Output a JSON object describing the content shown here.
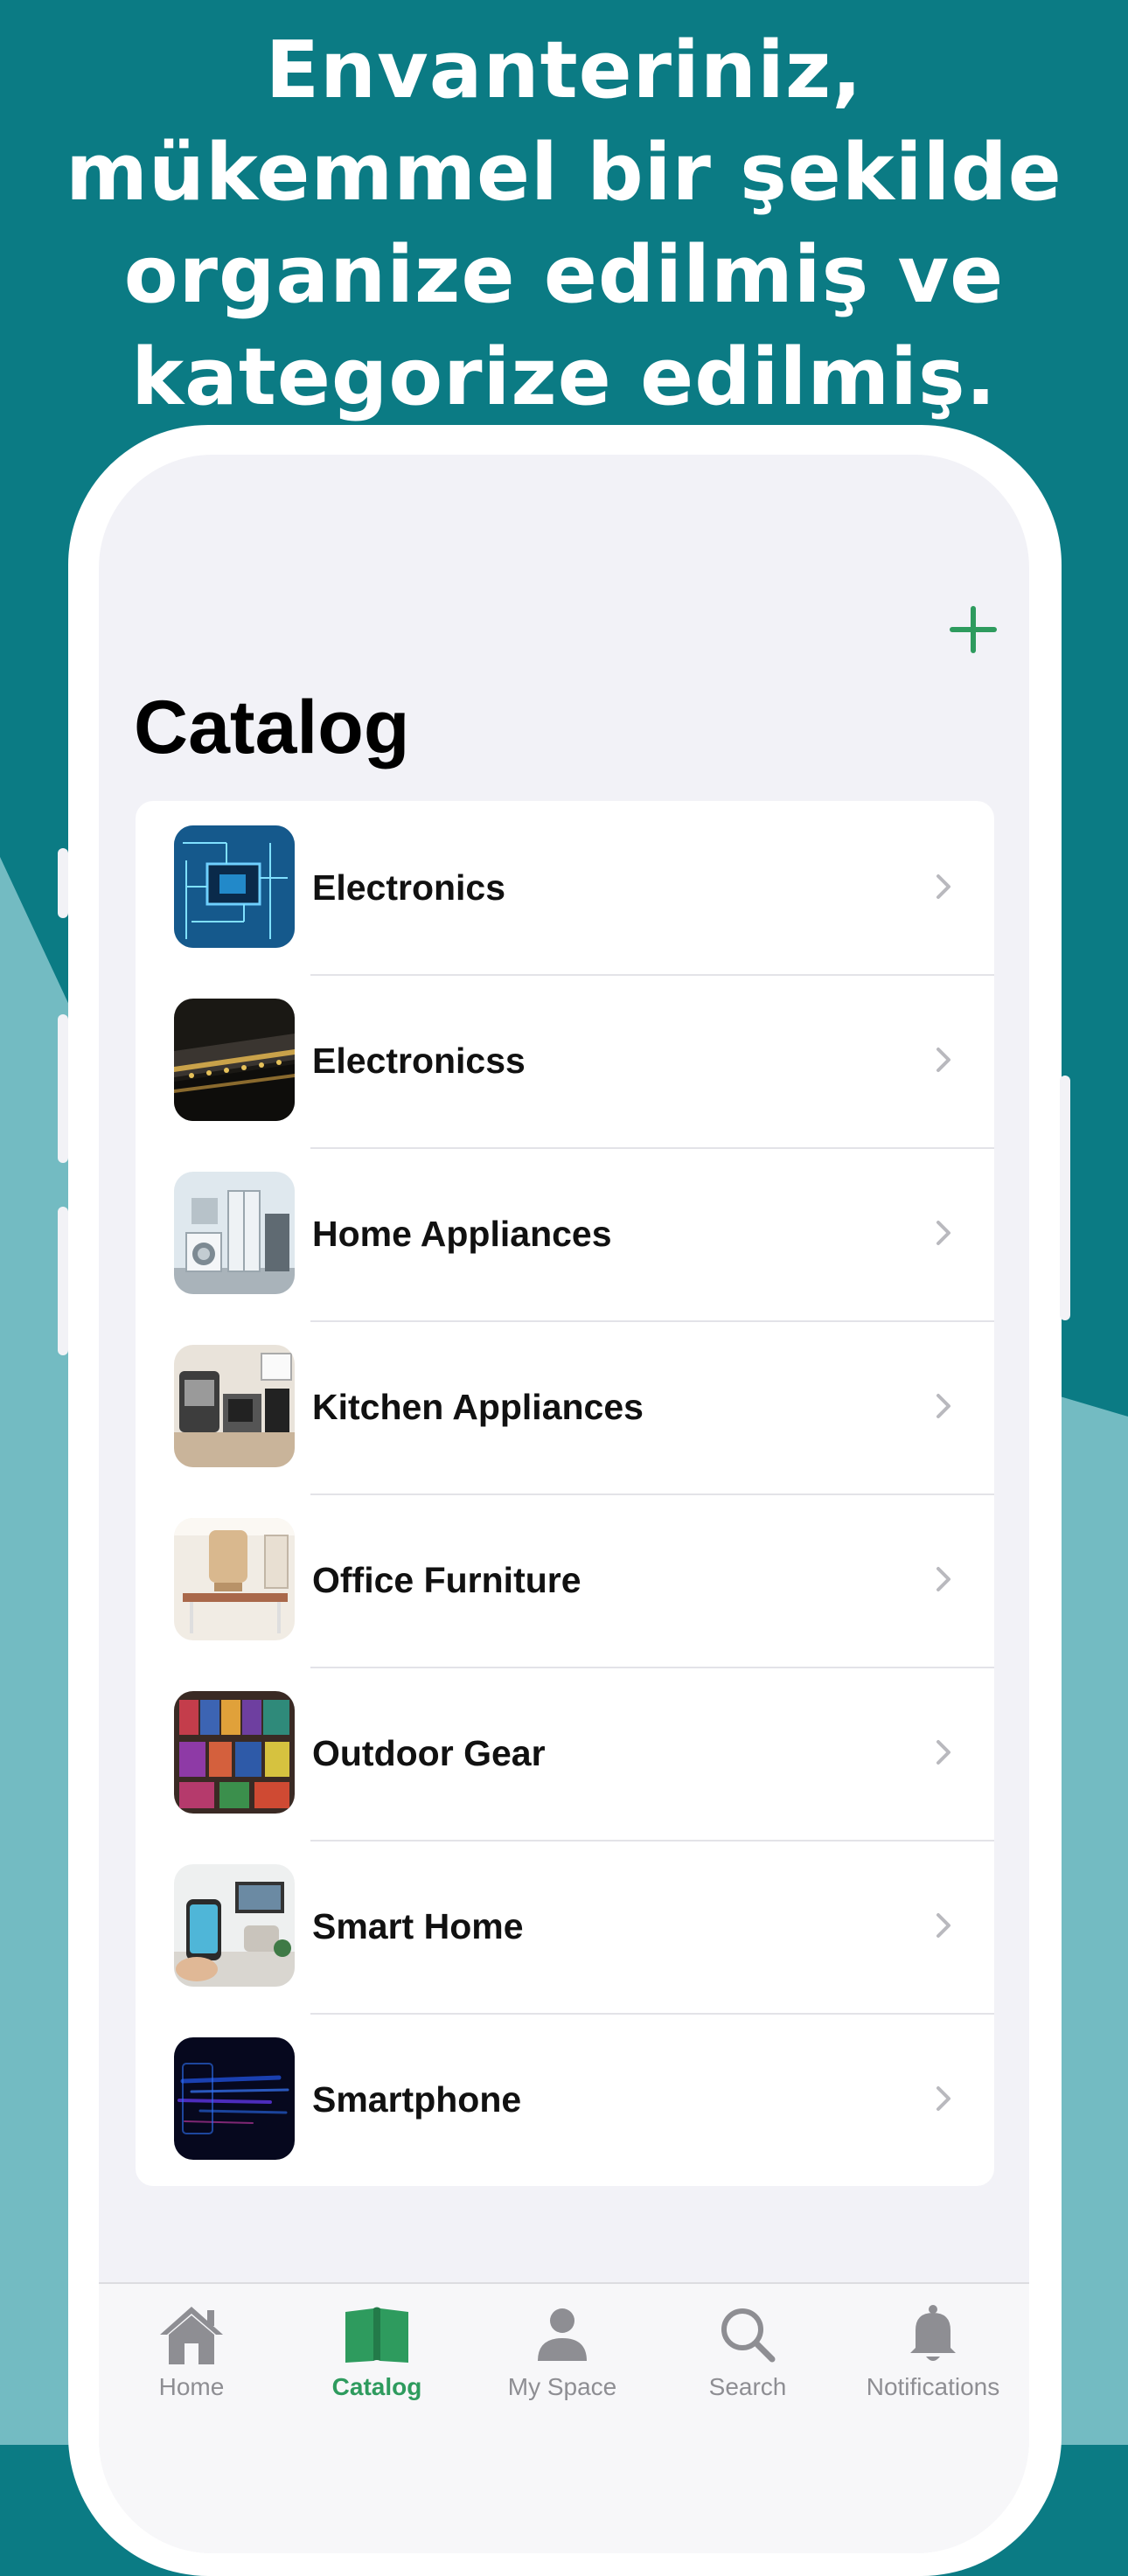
{
  "headline": {
    "line1": "Envanteriniz,",
    "line2": "mükemmel bir şekilde",
    "line3": "organize edilmiş ve",
    "line4": "kategorize edilmiş."
  },
  "colors": {
    "background_dark": "#0b7b84",
    "background_light": "#73bbc2",
    "accent": "#2e9b5e",
    "inactive": "#8e8e93"
  },
  "toolbar": {
    "add_icon": "plus-icon"
  },
  "page": {
    "title": "Catalog"
  },
  "catalog": {
    "items": [
      {
        "label": "Electronics",
        "icon": "circuit-board-thumbnail"
      },
      {
        "label": "Electronicss",
        "icon": "electronics-panel-thumbnail"
      },
      {
        "label": "Home Appliances",
        "icon": "home-appliances-thumbnail"
      },
      {
        "label": "Kitchen Appliances",
        "icon": "kitchen-appliances-thumbnail"
      },
      {
        "label": "Office Furniture",
        "icon": "office-furniture-thumbnail"
      },
      {
        "label": "Outdoor Gear",
        "icon": "outdoor-gear-thumbnail"
      },
      {
        "label": "Smart Home",
        "icon": "smart-home-thumbnail"
      },
      {
        "label": "Smartphone",
        "icon": "smartphone-thumbnail"
      }
    ]
  },
  "tabbar": {
    "tabs": [
      {
        "label": "Home",
        "icon": "house-icon",
        "active": false
      },
      {
        "label": "Catalog",
        "icon": "book-icon",
        "active": true
      },
      {
        "label": "My Space",
        "icon": "person-icon",
        "active": false
      },
      {
        "label": "Search",
        "icon": "magnifier-icon",
        "active": false
      },
      {
        "label": "Notifications",
        "icon": "bell-icon",
        "active": false
      }
    ]
  }
}
